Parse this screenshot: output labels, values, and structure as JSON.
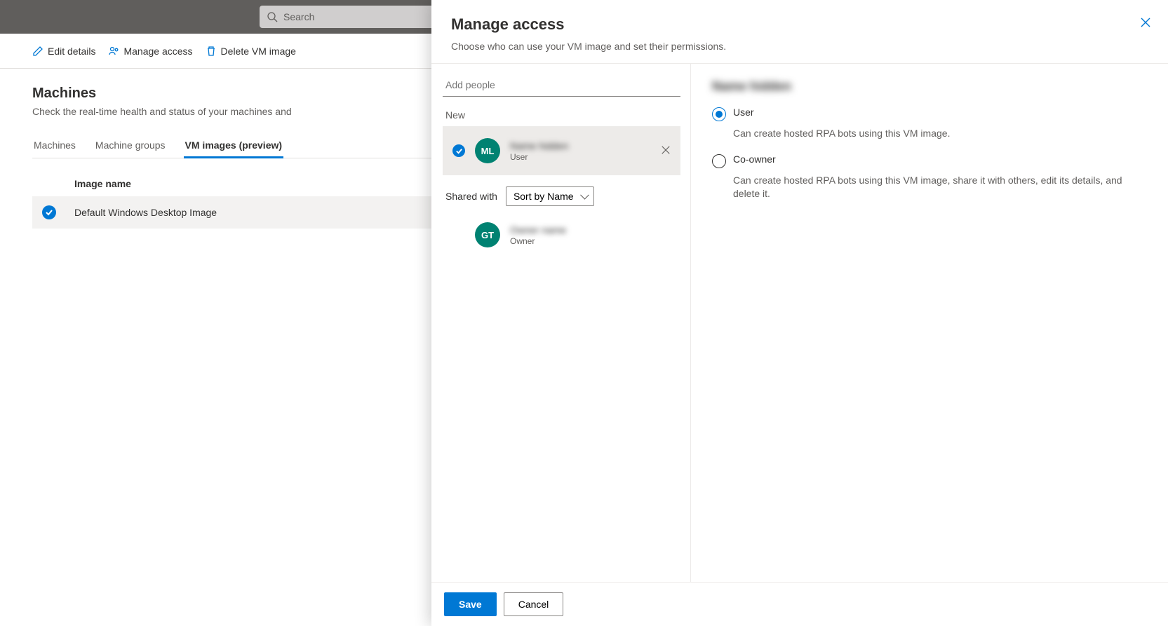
{
  "search": {
    "placeholder": "Search"
  },
  "toolbar": {
    "edit": "Edit details",
    "manage": "Manage access",
    "delete": "Delete VM image"
  },
  "page": {
    "title": "Machines",
    "subtitle": "Check the real-time health and status of your machines and"
  },
  "tabs": {
    "machines": "Machines",
    "groups": "Machine groups",
    "vmimages": "VM images (preview)"
  },
  "table": {
    "col": "Image name",
    "row1": "Default Windows Desktop Image"
  },
  "panel": {
    "title": "Manage access",
    "subtitle": "Choose who can use your VM image and set their permissions.",
    "addPlaceholder": "Add people",
    "newLabel": "New",
    "sharedWith": "Shared with",
    "sortBy": "Sort by Name",
    "save": "Save",
    "cancel": "Cancel"
  },
  "newPerson": {
    "initials": "ML",
    "name": "Name hidden",
    "role": "User"
  },
  "sharedPerson": {
    "initials": "GT",
    "name": "Owner name",
    "role": "Owner"
  },
  "perm": {
    "selectedName": "Name hidden",
    "user": "User",
    "userDesc": "Can create hosted RPA bots using this VM image.",
    "coowner": "Co-owner",
    "coownerDesc": "Can create hosted RPA bots using this VM image, share it with others, edit its details, and delete it."
  }
}
